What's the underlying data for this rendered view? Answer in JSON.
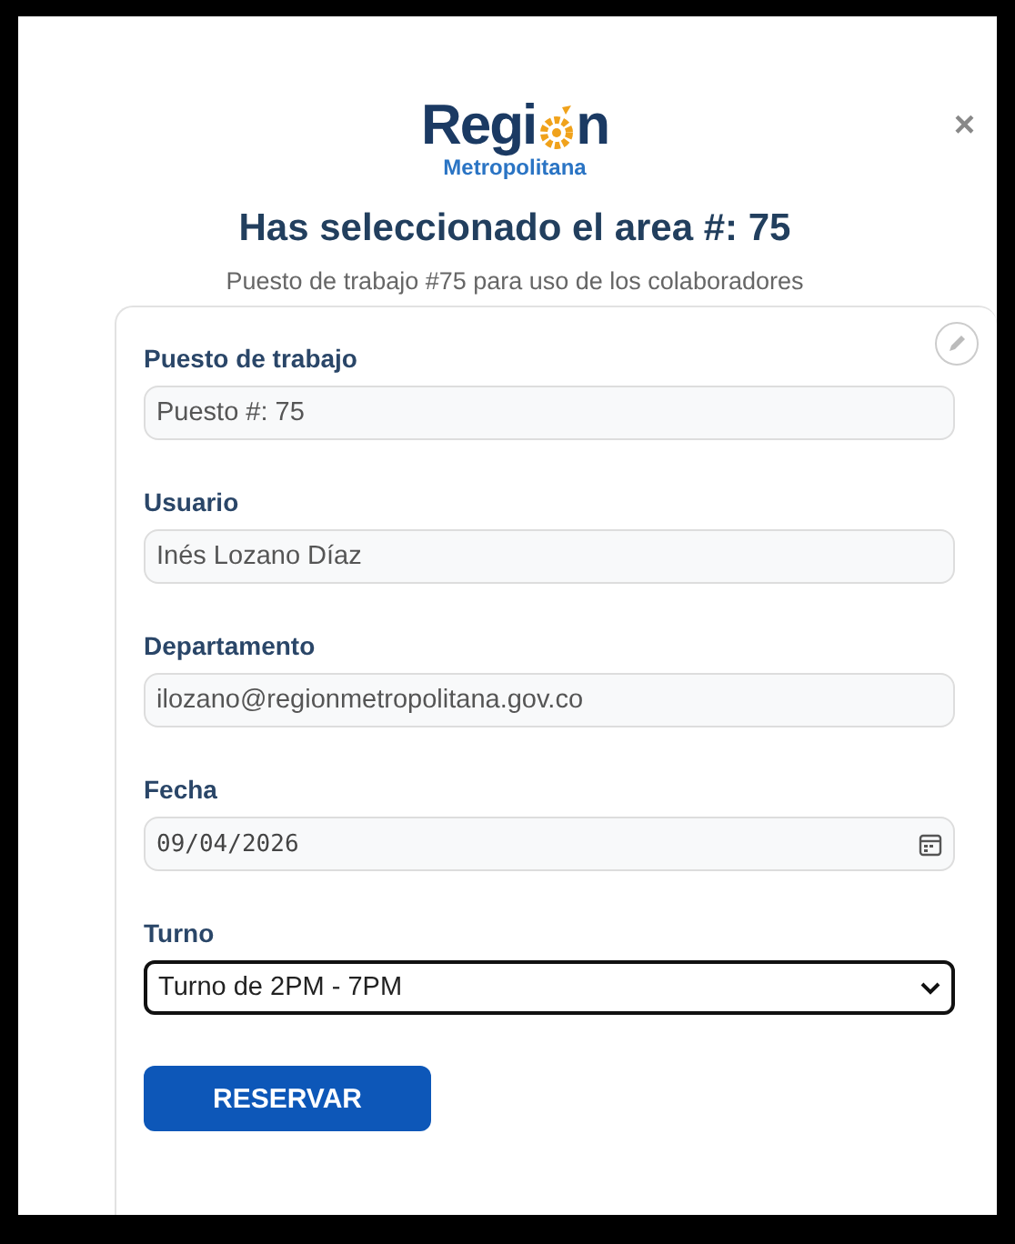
{
  "dialog": {
    "close": "×"
  },
  "logo": {
    "text_start": "Regi",
    "text_end": "n",
    "subtitle": "Metropolitana"
  },
  "title": "Has seleccionado el area #: 75",
  "subtitle": "Puesto de trabajo #75 para uso de los colaboradores",
  "fields": [
    {
      "kind": "text",
      "label": "Puesto de trabajo",
      "value": "Puesto #: 75",
      "focused": false
    },
    {
      "kind": "text",
      "label": "Usuario",
      "value": "Inés Lozano Díaz",
      "focused": false
    },
    {
      "kind": "text",
      "label": "Departamento",
      "value": "ilozano@regionmetropolitana.gov.co",
      "focused": false
    },
    {
      "kind": "date",
      "label": "Fecha",
      "value": "09/04/2026",
      "focused": false
    },
    {
      "kind": "select",
      "label": "Turno",
      "value": "Turno de 2PM - 7PM",
      "focused": true
    }
  ],
  "submit": "RESERVAR"
}
